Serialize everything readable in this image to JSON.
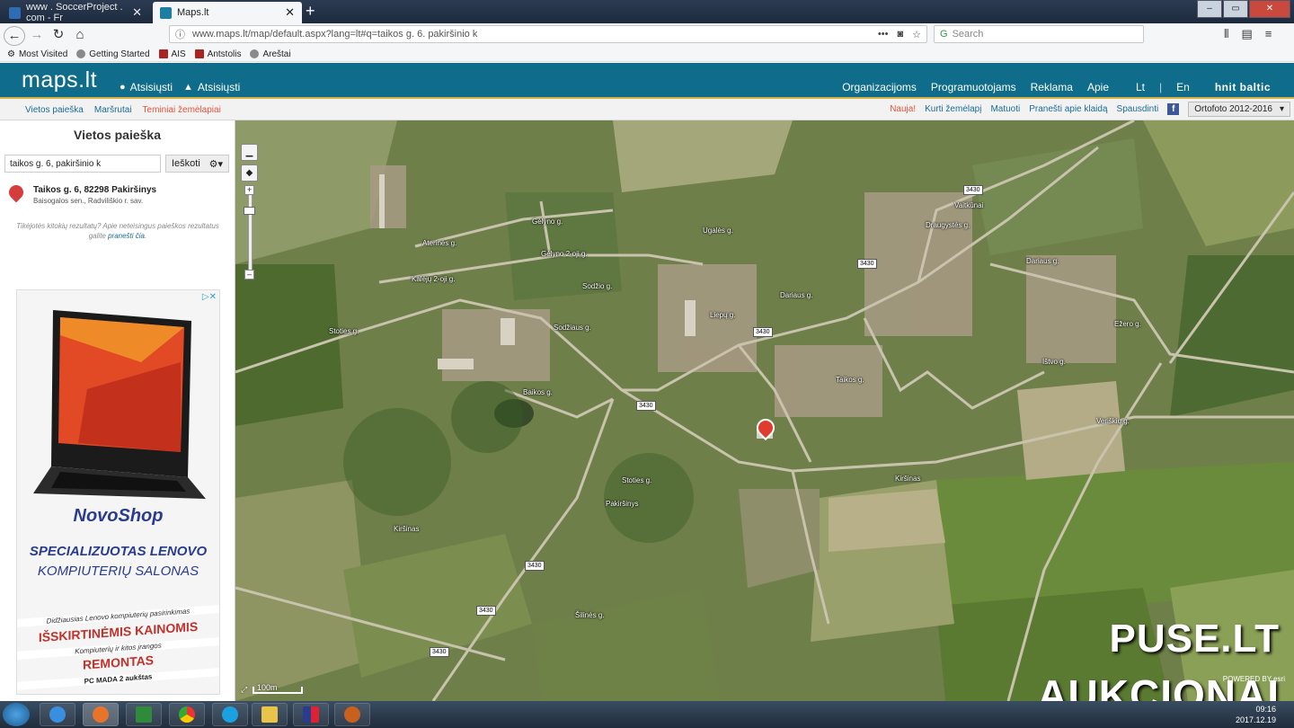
{
  "browser": {
    "tabs": [
      {
        "title": "www . SoccerProject . com - Fr",
        "active": false
      },
      {
        "title": "Maps.lt",
        "active": true
      }
    ],
    "url": "www.maps.lt/map/default.aspx?lang=lt#q=taikos g. 6. pakiršinio k",
    "search_placeholder": "Search",
    "bookmarks": [
      "Most Visited",
      "Getting Started",
      "AIS",
      "Antstolis",
      "Areštai"
    ]
  },
  "site": {
    "logo": "maps.lt",
    "downloads": [
      "Atsisiųsti",
      "Atsisiųsti"
    ],
    "menu": [
      "Organizacijoms",
      "Programuotojams",
      "Reklama",
      "Apie"
    ],
    "languages": [
      "Lt",
      "En"
    ],
    "brand": "hnit baltic"
  },
  "subnav": {
    "left": [
      "Vietos paieška",
      "Maršrutai",
      "Teminiai žemėlapiai"
    ],
    "right": [
      "Nauja!",
      "Kurti žemėlapį",
      "Matuoti",
      "Pranešti apie klaidą",
      "Spausdinti"
    ],
    "layer_select": "Ortofoto 2012-2016"
  },
  "panel": {
    "title": "Vietos paieška",
    "search_value": "taikos g. 6, pakiršinio k",
    "search_button": "Ieškoti",
    "result_title": "Taikos g. 6, 82298 Pakiršinys",
    "result_sub": "Baisogalos sen., Radviliškio r. sav.",
    "help_text": "Tikėjotės kitokių rezultatų? Apie neteisingus paieškos rezultatus galite",
    "help_link": "pranešti čia",
    "help_end": "."
  },
  "ad": {
    "brand": "NovoShop",
    "line1": "SPECIALIZUOTAS LENOVO",
    "line2": "KOMPIUTERIŲ SALONAS",
    "line3": "Didžiausias Lenovo kompiuterių pasirinkimas",
    "line4": "IŠSKIRTINĖMIS KAINOMIS",
    "line5": "Kompiuterių ir kitos įrangos",
    "line6": "REMONTAS",
    "line7": "PC MADA 2 aukštas"
  },
  "map": {
    "road_labels": [
      "Aterinės g.",
      "Gėlyno g.",
      "Gėlyno 2-oji g.",
      "Kalėjų 2-oji g.",
      "Sodžio g.",
      "Sodžiaus g.",
      "Stoties g.",
      "Baikos g.",
      "Taikos g.",
      "Liepų g.",
      "Dariaus g.",
      "Ugalės g.",
      "Vaitkūnai",
      "Ežero g.",
      "Kiršinas",
      "Kiršinas",
      "Pakiršinys",
      "Šilinės g.",
      "Dariaus g.",
      "Ištvo g.",
      "Stoties g.",
      "Draugystės g.",
      "Veriškių g."
    ],
    "route_labels": [
      "3430",
      "3430",
      "3430",
      "3430",
      "3430",
      "3430",
      "3430"
    ],
    "scale": "100m",
    "watermark1": "PUSE.LT",
    "watermark2": "AUKCIONAI",
    "attribution": "POWERED BY esri"
  },
  "taskbar": {
    "time": "09:16",
    "date": "2017.12.19"
  }
}
